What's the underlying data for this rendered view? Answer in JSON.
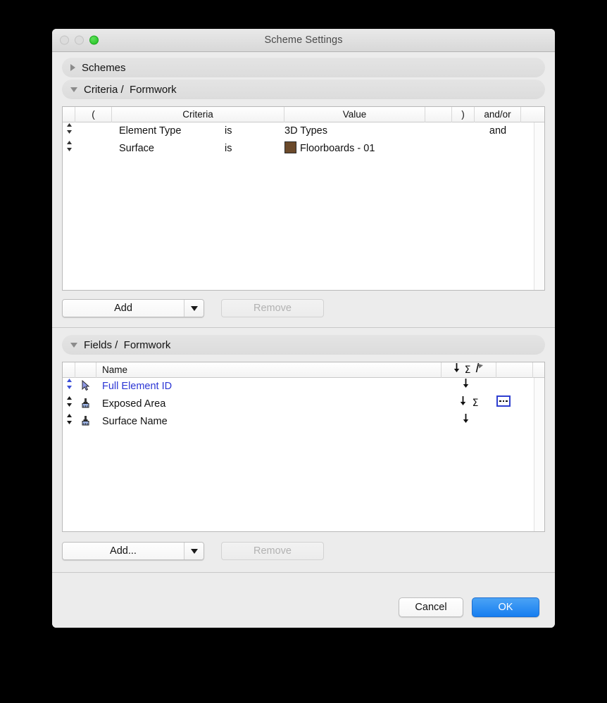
{
  "window": {
    "title": "Scheme Settings",
    "traffic_lights": [
      "close-disabled",
      "minimize-disabled",
      "zoom-green"
    ]
  },
  "sections": {
    "schemes": {
      "label": "Schemes",
      "expanded": false
    },
    "criteria": {
      "label": "Criteria /  Formwork",
      "expanded": true
    },
    "fields": {
      "label": "Fields /  Formwork",
      "expanded": true
    }
  },
  "criteria_table": {
    "columns": [
      "",
      "(",
      "Criteria",
      "",
      "Value",
      "",
      ")",
      "and/or",
      ""
    ],
    "rows": [
      {
        "handle": "sort-handle",
        "paren_open": "",
        "criteria": "Element Type",
        "operator": "is",
        "value": "3D Types",
        "swatch": null,
        "paren_close": "",
        "andor": "and"
      },
      {
        "handle": "sort-handle",
        "paren_open": "",
        "criteria": "Surface",
        "operator": "is",
        "value": "Floorboards - 01",
        "swatch": "#6b4a2b",
        "paren_close": "",
        "andor": ""
      }
    ]
  },
  "criteria_buttons": {
    "add_label": "Add",
    "add_dropdown_icon": "chevron-down-icon",
    "remove_label": "Remove",
    "remove_enabled": false
  },
  "fields_table": {
    "columns": [
      "",
      "",
      "Name",
      "sort-down-icon",
      "sigma-icon",
      "flag-icon",
      ""
    ],
    "rows": [
      {
        "handle": "sort-handle",
        "handle_selected": true,
        "icon": "cursor-arrow-icon",
        "name": "Full Element ID",
        "name_highlighted": true,
        "sort": "↓",
        "sum": "",
        "options": false
      },
      {
        "handle": "sort-handle",
        "handle_selected": false,
        "icon": "paintbrush-icon",
        "name": "Exposed Area",
        "name_highlighted": false,
        "sort": "↓",
        "sum": "Σ",
        "options": true
      },
      {
        "handle": "sort-handle",
        "handle_selected": false,
        "icon": "paintbrush-icon",
        "name": "Surface Name",
        "name_highlighted": false,
        "sort": "↓",
        "sum": "",
        "options": false
      }
    ]
  },
  "fields_buttons": {
    "add_label": "Add...",
    "add_dropdown_icon": "chevron-down-icon",
    "remove_label": "Remove",
    "remove_enabled": false
  },
  "footer": {
    "cancel_label": "Cancel",
    "ok_label": "OK"
  },
  "colors": {
    "accent_blue": "#177ef0",
    "highlight_text": "#2b35d4",
    "swatch_brown": "#6b4a2b",
    "window_bg": "#ececec"
  }
}
